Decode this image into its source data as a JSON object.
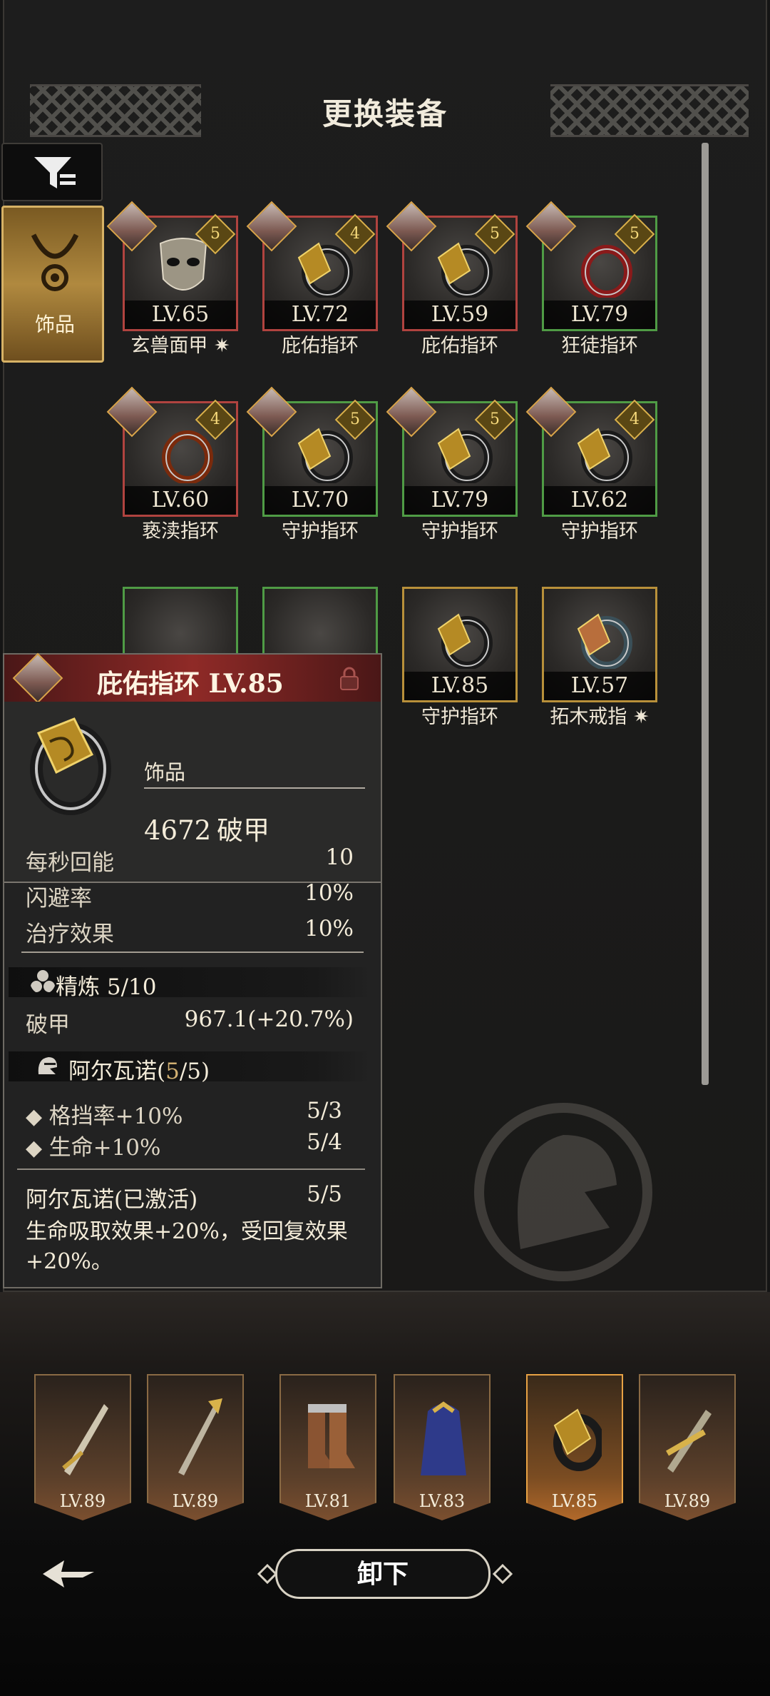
{
  "dialog": {
    "title": "更换装备"
  },
  "side_tabs": {
    "accessory_label": "饰品"
  },
  "cards": [
    {
      "level": "LV.65",
      "name": "玄兽面甲",
      "star": true,
      "quality": "red",
      "badge": "5",
      "kind": "mask"
    },
    {
      "level": "LV.72",
      "name": "庇佑指环",
      "star": false,
      "quality": "red",
      "badge": "4",
      "kind": "ring"
    },
    {
      "level": "LV.59",
      "name": "庇佑指环",
      "star": false,
      "quality": "red",
      "badge": "5",
      "kind": "ring"
    },
    {
      "level": "LV.79",
      "name": "狂徒指环",
      "star": false,
      "quality": "green",
      "badge": "5",
      "kind": "ring-red"
    },
    {
      "level": "LV.60",
      "name": "亵渎指环",
      "star": false,
      "quality": "red",
      "badge": "4",
      "kind": "ring-fire"
    },
    {
      "level": "LV.70",
      "name": "守护指环",
      "star": false,
      "quality": "green",
      "badge": "5",
      "kind": "ring"
    },
    {
      "level": "LV.79",
      "name": "守护指环",
      "star": false,
      "quality": "green",
      "badge": "5",
      "kind": "ring"
    },
    {
      "level": "LV.62",
      "name": "守护指环",
      "star": false,
      "quality": "green",
      "badge": "4",
      "kind": "ring"
    },
    {
      "level": "LV.85",
      "name": "守护指环",
      "star": false,
      "quality": "gold",
      "badge": "",
      "kind": "ring"
    },
    {
      "level": "LV.57",
      "name": "拓木戒指",
      "star": true,
      "quality": "gold",
      "badge": "",
      "kind": "ring-blue"
    }
  ],
  "tooltip": {
    "name": "庇佑指环 LV.85",
    "category": "饰品",
    "main_value": "4672",
    "main_stat": "破甲",
    "stats": [
      {
        "label": "每秒回能",
        "value": "10"
      },
      {
        "label": "闪避率",
        "value": "10%"
      },
      {
        "label": "治疗效果",
        "value": "10%"
      }
    ],
    "refine_label": "精炼 5/10",
    "refine_stat": {
      "label": "破甲",
      "value": "967.1(+20.7%)"
    },
    "set": {
      "name": "阿尔瓦诺(",
      "count_current": "5",
      "count_rest": "/5)",
      "bonuses": [
        {
          "label": "格挡率+10%",
          "value": "5/3"
        },
        {
          "label": "生命+10%",
          "value": "5/4"
        }
      ],
      "active_label": "阿尔瓦诺(已激活)",
      "active_value": "5/5",
      "description": "生命吸取效果+20%，受回复效果+20%。"
    }
  },
  "equipped": [
    {
      "level": "LV.89",
      "kind": "sword"
    },
    {
      "level": "LV.89",
      "kind": "spear"
    },
    {
      "level": "LV.81",
      "kind": "boots"
    },
    {
      "level": "LV.83",
      "kind": "cape"
    },
    {
      "level": "LV.85",
      "kind": "ring",
      "selected": true
    },
    {
      "level": "LV.89",
      "kind": "blade"
    }
  ],
  "actions": {
    "unequip_label": "卸下"
  },
  "colors": {
    "red": "#b0433f",
    "green": "#4f9b45",
    "gold": "#b8903a",
    "set_count": "#d1b072"
  }
}
